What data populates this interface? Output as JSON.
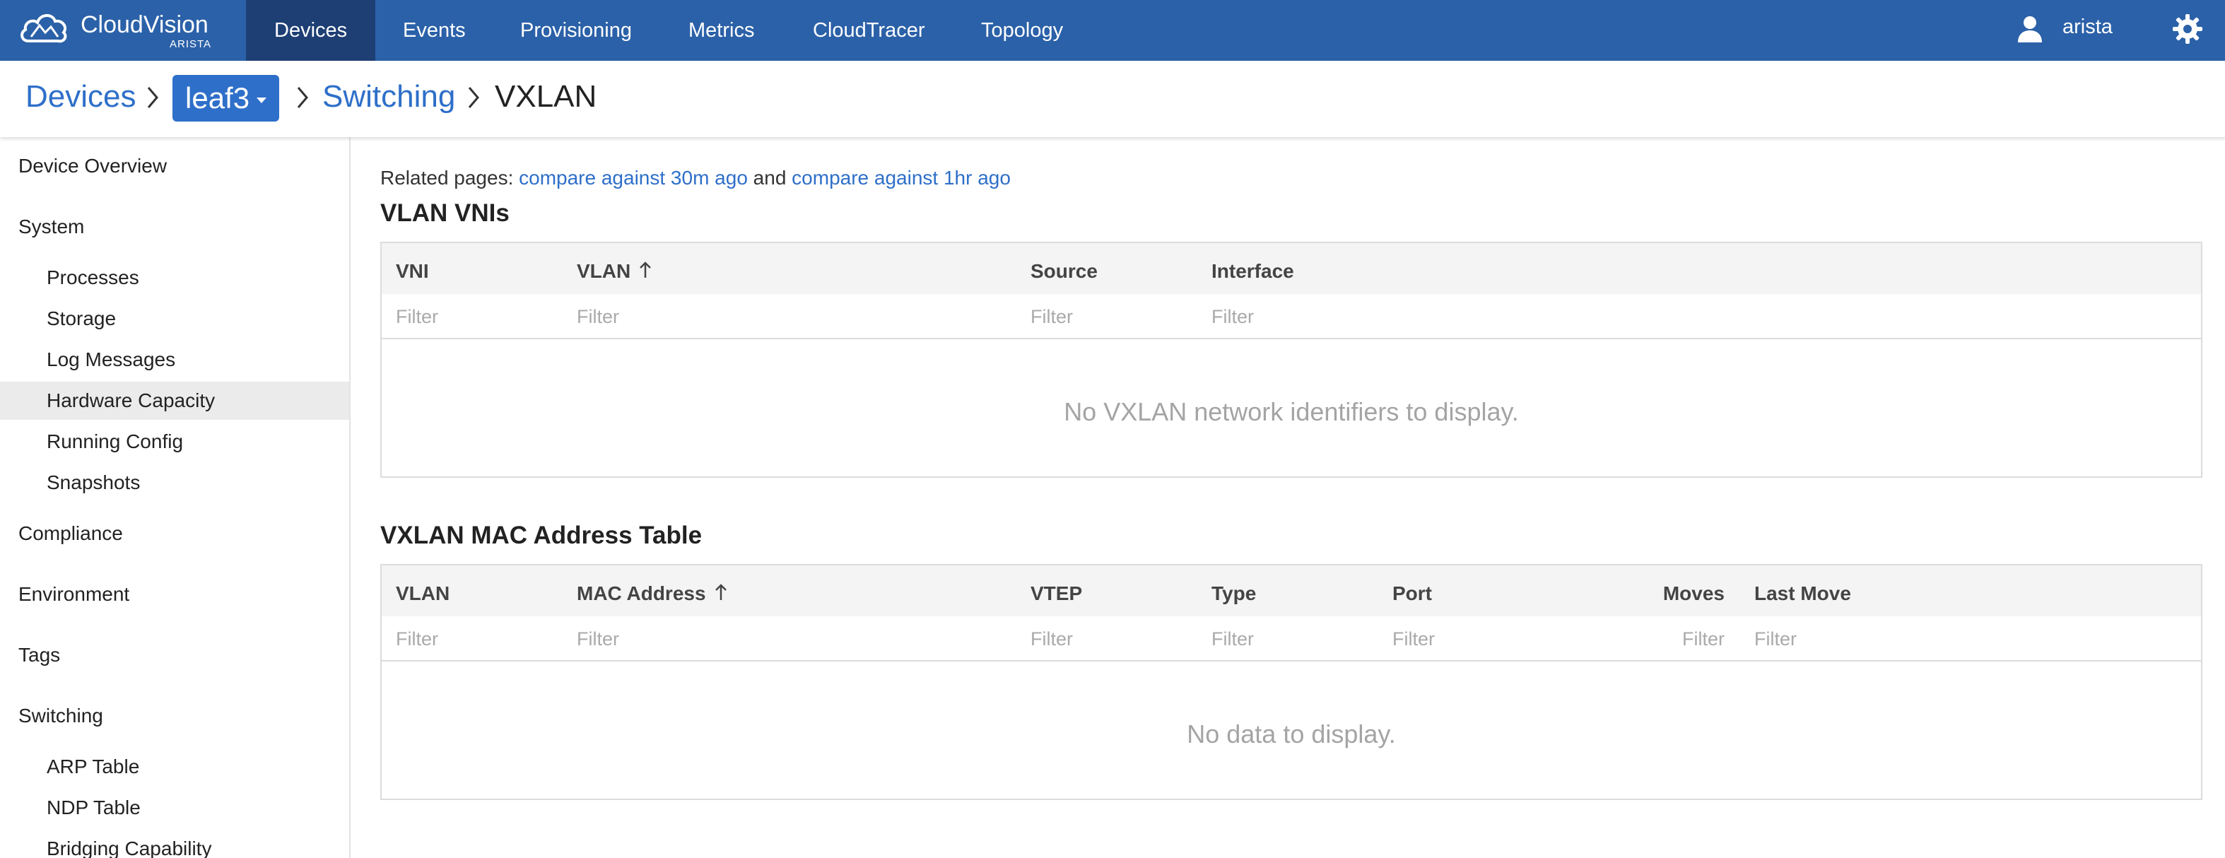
{
  "app": {
    "name": "CloudVision",
    "vendor": "ARISTA",
    "nav": [
      "Devices",
      "Events",
      "Provisioning",
      "Metrics",
      "CloudTracer",
      "Topology"
    ],
    "active_nav": "Devices",
    "user": "arista",
    "icons": {
      "logo": "cloud-logo-icon",
      "user": "user-icon",
      "settings": "gear-icon"
    }
  },
  "breadcrumb": {
    "devices": "Devices",
    "device": "leaf3",
    "section": "Switching",
    "current": "VXLAN"
  },
  "sidebar": {
    "device_overview": "Device Overview",
    "system": "System",
    "system_items": [
      "Processes",
      "Storage",
      "Log Messages",
      "Hardware Capacity",
      "Running Config",
      "Snapshots"
    ],
    "active_item": "Hardware Capacity",
    "compliance": "Compliance",
    "environment": "Environment",
    "tags": "Tags",
    "switching": "Switching",
    "switching_items": [
      "ARP Table",
      "NDP Table",
      "Bridging Capability"
    ]
  },
  "main": {
    "related_prefix": "Related pages:",
    "related_link_1": "compare against 30m ago",
    "related_and": "and",
    "related_link_2": "compare against 1hr ago",
    "vni_table": {
      "title": "VLAN VNIs",
      "columns": [
        "VNI",
        "VLAN",
        "Source",
        "Interface"
      ],
      "sorted_column": "VLAN",
      "filter_placeholder": "Filter",
      "empty_message": "No VXLAN network identifiers to display."
    },
    "mac_table": {
      "title": "VXLAN MAC Address Table",
      "columns": [
        "VLAN",
        "MAC Address",
        "VTEP",
        "Type",
        "Port",
        "Moves",
        "Last Move"
      ],
      "sorted_column": "MAC Address",
      "filter_placeholder": "Filter",
      "empty_message": "No data to display."
    }
  },
  "colors": {
    "nav_bg": "#2b61a8",
    "nav_active": "#1d3f74",
    "link": "#2e6fc9",
    "sidebar_active": "#ebebeb"
  }
}
